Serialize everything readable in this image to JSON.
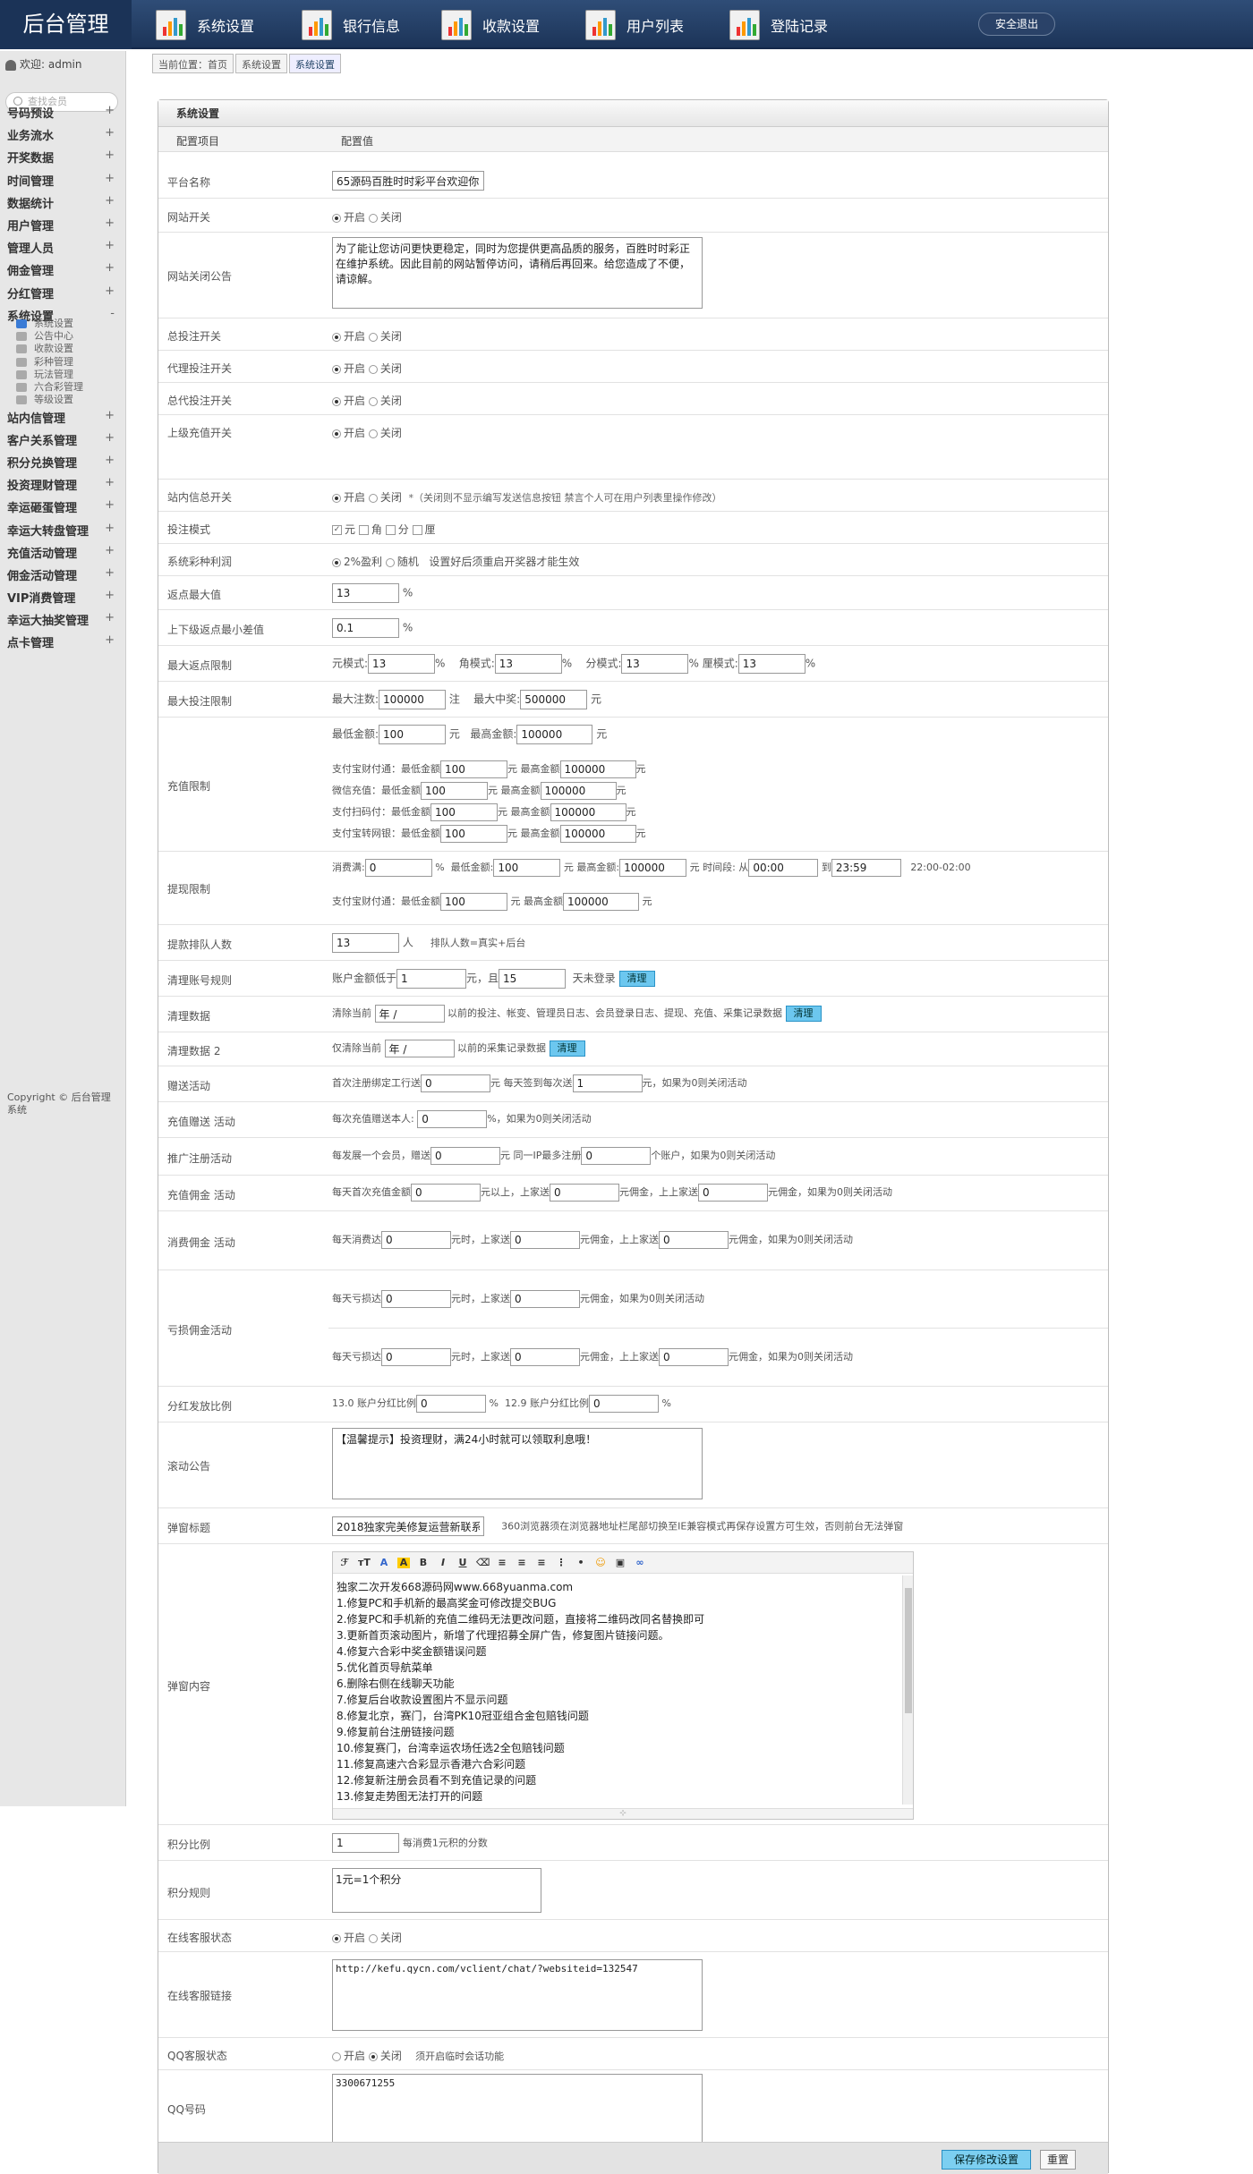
{
  "header": {
    "logo": "后台管理",
    "nav": [
      "系统设置",
      "银行信息",
      "收款设置",
      "用户列表",
      "登陆记录"
    ],
    "logout": "安全退出"
  },
  "side": {
    "user": "欢迎: admin",
    "search_placeholder": "查找会员",
    "menu1": [
      "号码预设",
      "业务流水",
      "开奖数据",
      "时间管理",
      "数据统计",
      "用户管理",
      "管理人员",
      "佣金管理",
      "分红管理",
      "系统设置"
    ],
    "submenu": [
      "系统设置",
      "公告中心",
      "收款设置",
      "彩种管理",
      "玩法管理",
      "六合彩管理",
      "等级设置"
    ],
    "menu2": [
      "站内信管理",
      "客户关系管理",
      "积分兑换管理",
      "投资理财管理",
      "幸运砸蛋管理",
      "幸运大转盘管理",
      "充值活动管理",
      "佣金活动管理",
      "VIP消费管理",
      "幸运大抽奖管理",
      "点卡管理"
    ],
    "copyright": "Copyright © 后台管理系统"
  },
  "breadcrumb": [
    "当前位置：首页",
    "系统设置",
    "系统设置"
  ],
  "panel": {
    "title": "系统设置",
    "col1": "配置项目",
    "col2": "配置值"
  },
  "labels": {
    "platform": "平台名称",
    "site_switch": "网站开关",
    "close_notice": "网站关闭公告",
    "bet_switch": "总投注开关",
    "agent_bet": "代理投注开关",
    "general_agent_bet": "总代投注开关",
    "superior_recharge": "上级充值开关",
    "mail_switch": "站内信总开关",
    "bet_mode": "投注模式",
    "lottery_profit": "系统彩种利润",
    "rebate_max": "返点最大值",
    "rebate_diff": "上下级返点最小差值",
    "rebate_limit": "最大返点限制",
    "bet_limit": "最大投注限制",
    "recharge_limit": "充值限制",
    "withdraw_limit": "提现限制",
    "queue": "提款排队人数",
    "clean_rule": "清理账号规则",
    "clean_data": "清理数据",
    "clean_data2": "清理数据 2",
    "gift": "赠送活动",
    "recharge_gift": "充值赠送 活动",
    "promo_reg": "推广注册活动",
    "recharge_comm": "充值佣金 活动",
    "consume_comm": "消费佣金 活动",
    "loss_comm": "亏损佣金活动",
    "dividend": "分红发放比例",
    "scroll": "滚动公告",
    "popup_title": "弹窗标题",
    "popup_content": "弹窗内容",
    "points_ratio": "积分比例",
    "points_rule": "积分规则",
    "cs_status": "在线客服状态",
    "cs_link": "在线客服链接",
    "qq_status": "QQ客服状态",
    "qq_number": "QQ号码"
  },
  "values": {
    "platform": "65源码百胜时时彩平台欢迎你",
    "on": "开启",
    "off": "关闭",
    "close_notice": "为了能让您访问更快更稳定，同时为您提供更高品质的服务，百胜时时彩正在维护系统。因此目前的网站暂停访问，请稍后再回来。给您造成了不便，请谅解。",
    "mail_note": "*（关闭则不显示编写发送信息按钮 禁言个人可在用户列表里操作修改）",
    "modes": [
      "元",
      "角",
      "分",
      "厘"
    ],
    "profit_opt1": "2%盈利",
    "profit_opt2": "随机",
    "profit_note": "设置好后须重启开奖器才能生效",
    "rebate_max": "13",
    "rebate_diff": "0.1",
    "pct": "%",
    "rebate_yuan_lbl": "元模式:",
    "rebate_jiao_lbl": "角模式:",
    "rebate_fen_lbl": "分模式:",
    "rebate_li_lbl": "厘模式:",
    "rebate_yuan": "13",
    "rebate_jiao": "13",
    "rebate_fen": "13",
    "rebate_li": "13",
    "max_bets_lbl": "最大注数:",
    "max_bets": "100000",
    "unit_zhu": "注",
    "max_win_lbl": "最大中奖:",
    "max_win": "500000",
    "yuan": "元",
    "min_amt_lbl": "最低金额:",
    "max_amt_lbl": "最高金额:",
    "rc_min": "100",
    "rc_max": "100000",
    "alipay_lbl": "支付宝财付通：最低金额",
    "wechat_lbl": "微信充值：最低金额",
    "scan_lbl": "支付扫码付：最低金额",
    "alibank_lbl": "支付宝转网银：最低金额",
    "max_amt2": "最高金额",
    "alipay_min": "100",
    "alipay_max": "100000",
    "wechat_min": "100",
    "wechat_max": "100000",
    "scan_min": "100",
    "scan_max": "100000",
    "alibank_min": "100",
    "alibank_max": "100000",
    "fee_lbl": "消费满:",
    "fee": "0",
    "wd_min": "100",
    "wd_max": "100000",
    "period_lbl": "时间段: 从",
    "to_lbl": "到",
    "t_from": "00:00",
    "t_to": "23:59",
    "period_note": "22:00-02:00",
    "wd_alipay_min": "100",
    "wd_alipay_max": "100000",
    "queue": "13",
    "person": "人",
    "queue_note": "排队人数=真实+后台",
    "clean_pre": "账户金额低于",
    "clean_amt": "1",
    "clean_mid": "元，且",
    "clean_days": "15",
    "clean_post": "天未登录",
    "clean_btn": "清理",
    "cd_pre": "清除当前",
    "cd_sel": "年 /",
    "cd_post": "以前的投注、帐变、管理员日志、会员登录日志、提现、充值、采集记录数据",
    "cd2_pre": "仅清除当前",
    "cd2_post": "以前的采集记录数据",
    "gift_pre": "首次注册绑定工行送",
    "gift_v1": "0",
    "gift_mid": "元  每天签到每次送",
    "gift_v2": "1",
    "gift_post": "元，如果为0则关闭活动",
    "rg_pre": "每次充值赠送本人:",
    "rg_v": "0",
    "rg_post": "%，如果为0则关闭活动",
    "pr_pre": "每发展一个会员，赠送",
    "pr_v1": "0",
    "pr_mid": "元  同一IP最多注册",
    "pr_v2": "0",
    "pr_post": "个账户，如果为0则关闭活动",
    "rcm_pre": "每天首次充值金额",
    "rcm_v1": "0",
    "rcm_m1": "元以上，上家送",
    "rcm_v2": "0",
    "rcm_m2": "元佣金，上上家送",
    "rcm_v3": "0",
    "rcm_post": "元佣金，如果为0则关闭活动",
    "cc_pre": "每天消费达",
    "cc_v1": "0",
    "cc_m1": "元时，上家送",
    "cc_v2": "0",
    "cc_m2": "元佣金，上上家送",
    "cc_v3": "0",
    "cc_post": "元佣金，如果为0则关闭活动",
    "lc_pre": "每天亏损达",
    "lc_v1": "0",
    "lc_v2": "0",
    "lc_post1": "元佣金，如果为0则关闭活动",
    "lc_v3": "0",
    "lc_v4": "0",
    "lc_v5": "0",
    "dv1_lbl": "13.0 账户分红比例",
    "dv1": "0",
    "dv2_lbl": "12.9 账户分红比例",
    "dv2": "0",
    "scroll": "【温馨提示】投资理财，满24小时就可以领取利息哦！",
    "popup_title": "2018独家完美修复运营新联系",
    "popup_note": "360浏览器须在浏览器地址栏尾部切换至IE兼容模式再保存设置方可生效，否则前台无法弹窗",
    "popup_lines": [
      "独家二次开发668源码网www.668yuanma.com",
      "1.修复PC和手机新的最高奖金可修改提交BUG",
      "2.修复PC和手机新的充值二维码无法更改问题，直接将二维码改同名替换即可",
      "3.更新首页滚动图片，新增了代理招募全屏广告，修复图片链接问题。",
      "4.修复六合彩中奖金额错误问题",
      "5.优化首页导航菜单",
      "6.删除右侧在线聊天功能",
      "7.修复后台收款设置图片不显示问题",
      "8.修复北京，赛门，台湾PK10冠亚组合金包赔钱问题",
      "9.修复前台注册链接问题",
      "10.修复赛门，台湾幸运农场任选2全包赔钱问题",
      "11.修复高速六合彩显示香港六合彩问题",
      "12.修复新注册会员看不到充值记录的问题",
      "13.修复走势图无法打开的问题"
    ],
    "points": "1",
    "points_note": "每消费1元积的分数",
    "points_rule": "1元=1个积分",
    "cs_link": "http://kefu.qycn.com/vclient/chat/?websiteid=132547",
    "qq_note": "须开启临时会话功能",
    "qq_number": "3300671255",
    "save": "保存修改设置",
    "reset": "重置"
  }
}
